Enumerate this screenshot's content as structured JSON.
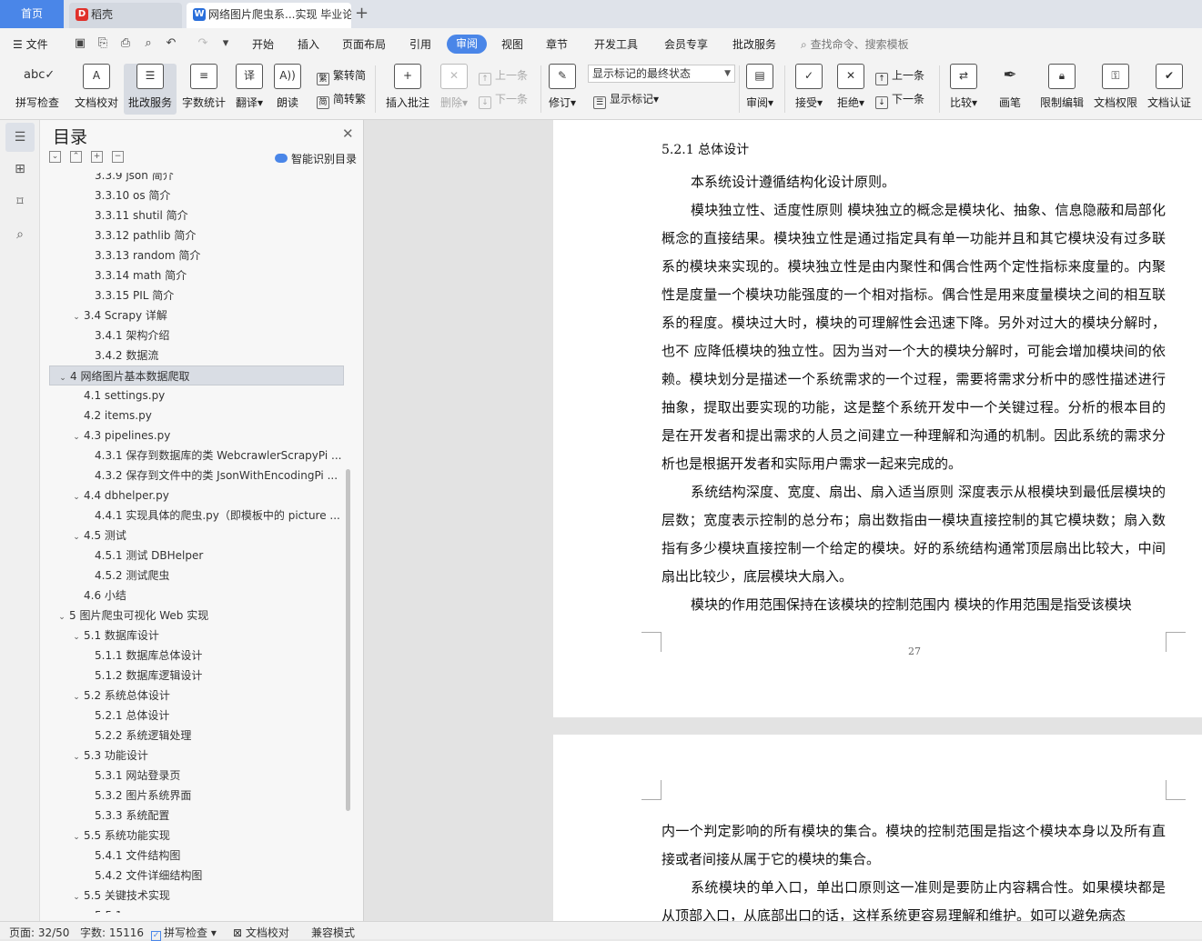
{
  "tabs": {
    "home": "首页",
    "tab1": "稻壳",
    "tab2": "网络图片爬虫系...实现 毕业论"
  },
  "menu": {
    "file": "文件",
    "items": [
      "开始",
      "插入",
      "页面布局",
      "引用",
      "审阅",
      "视图",
      "章节",
      "开发工具",
      "会员专享",
      "批改服务"
    ],
    "active": "审阅",
    "search": "查找命令、搜索模板"
  },
  "ribbon": {
    "spellcheck": "拼写检查",
    "proofread": "文档校对",
    "review_service": "批改服务",
    "word_count": "字数统计",
    "translate": "翻译",
    "read_aloud": "朗读",
    "to_traditional": "繁转简",
    "to_simplified": "简转繁",
    "insert_comment": "插入批注",
    "delete": "删除",
    "prev_comment": "上一条",
    "next_comment": "下一条",
    "revise": "修订",
    "markup_select": "显示标记的最终状态",
    "show_markup": "显示标记",
    "review": "审阅",
    "accept": "接受",
    "reject": "拒绝",
    "prev_change": "上一条",
    "next_change": "下一条",
    "compare": "比较",
    "pen": "画笔",
    "restrict_edit": "限制编辑",
    "doc_permission": "文档权限",
    "doc_auth": "文档认证"
  },
  "toc": {
    "title": "目录",
    "smart": "智能识别目录",
    "items": [
      {
        "label": "3.3.9  json 简介",
        "level": 3
      },
      {
        "label": "3.3.10 os 简介",
        "level": 3
      },
      {
        "label": "3.3.11 shutil 简介",
        "level": 3
      },
      {
        "label": "3.3.12 pathlib 简介",
        "level": 3
      },
      {
        "label": "3.3.13 random 简介",
        "level": 3
      },
      {
        "label": "3.3.14 math 简介",
        "level": 3
      },
      {
        "label": "3.3.15 PIL 简介",
        "level": 3
      },
      {
        "label": "3.4 Scrapy 详解",
        "level": 2,
        "expanded": true
      },
      {
        "label": "3.4.1  架构介绍",
        "level": 3
      },
      {
        "label": "3.4.2  数据流",
        "level": 3
      },
      {
        "label": "4  网络图片基本数据爬取",
        "level": 1,
        "expanded": true,
        "selected": true
      },
      {
        "label": "4.1 settings.py",
        "level": 2
      },
      {
        "label": "4.2 items.py",
        "level": 2
      },
      {
        "label": "4.3 pipelines.py",
        "level": 2,
        "expanded": true
      },
      {
        "label": "4.3.1 保存到数据库的类 WebcrawlerScrapyPi ...",
        "level": 3
      },
      {
        "label": "4.3.2 保存到文件中的类 JsonWithEncodingPi ...",
        "level": 3
      },
      {
        "label": "4.4 dbhelper.py",
        "level": 2,
        "expanded": true
      },
      {
        "label": "4.4.1 实现具体的爬虫.py（即模板中的 picture ...",
        "level": 3
      },
      {
        "label": "4.5 测试",
        "level": 2,
        "expanded": true
      },
      {
        "label": "4.5.1 测试  DBHelper",
        "level": 3
      },
      {
        "label": "4.5.2 测试爬虫",
        "level": 3
      },
      {
        "label": "4.6 小结",
        "level": 2
      },
      {
        "label": "5  图片爬虫可视化 Web 实现",
        "level": 1,
        "expanded": true
      },
      {
        "label": "5.1  数据库设计",
        "level": 2,
        "expanded": true
      },
      {
        "label": "5.1.1  数据库总体设计",
        "level": 3
      },
      {
        "label": "5.1.2  数据库逻辑设计",
        "level": 3
      },
      {
        "label": "5.2  系统总体设计",
        "level": 2,
        "expanded": true
      },
      {
        "label": "5.2.1  总体设计",
        "level": 3
      },
      {
        "label": "5.2.2  系统逻辑处理",
        "level": 3
      },
      {
        "label": "5.3  功能设计",
        "level": 2,
        "expanded": true
      },
      {
        "label": "5.3.1  网站登录页",
        "level": 3
      },
      {
        "label": "5.3.2  图片系统界面",
        "level": 3
      },
      {
        "label": "5.3.3  系统配置",
        "level": 3
      },
      {
        "label": "5.5  系统功能实现",
        "level": 2,
        "expanded": true
      },
      {
        "label": "5.4.1  文件结构图",
        "level": 3
      },
      {
        "label": "5.4.2  文件详细结构图",
        "level": 3
      },
      {
        "label": "5.5  关键技术实现",
        "level": 2,
        "expanded": true
      },
      {
        "label": "5.5.1  ...",
        "level": 3
      }
    ]
  },
  "document": {
    "heading": "5.2.1  总体设计",
    "page1_paragraphs": [
      "本系统设计遵循结构化设计原则。",
      "模块独立性、适度性原则  模块独立的概念是模块化、抽象、信息隐蔽和局部化概念的直接结果。模块独立性是通过指定具有单一功能并且和其它模块没有过多联系的模块来实现的。模块独立性是由内聚性和偶合性两个定性指标来度量的。内聚性是度量一个模块功能强度的一个相对指标。偶合性是用来度量模块之间的相互联系的程度。模块过大时，模块的可理解性会迅速下降。另外对过大的模块分解时，也不  应降低模块的独立性。因为当对一个大的模块分解时，可能会增加模块间的依赖。模块划分是描述一个系统需求的一个过程，需要将需求分析中的感性描述进行抽象，提取出要实现的功能，这是整个系统开发中一个关键过程。分析的根本目的是在开发者和提出需求的人员之间建立一种理解和沟通的机制。因此系统的需求分析也是根据开发者和实际用户需求一起来完成的。",
      "系统结构深度、宽度、扇出、扇入适当原则  深度表示从根模块到最低层模块的层数；宽度表示控制的总分布；扇出数指由一模块直接控制的其它模块数；扇入数指有多少模块直接控制一个给定的模块。好的系统结构通常顶层扇出比较大，中间扇出比较少，底层模块大扇入。",
      "模块的作用范围保持在该模块的控制范围内  模块的作用范围是指受该模块"
    ],
    "page_number": "27",
    "page2_paragraphs": [
      "内一个判定影响的所有模块的集合。模块的控制范围是指这个模块本身以及所有直接或者间接从属于它的模块的集合。",
      "系统模块的单入口，单出口原则这一准则是要防止内容耦合性。如果模块都是从顶部入口，从底部出口的话，这样系统更容易理解和维护。如可以避免病态"
    ]
  },
  "status": {
    "page": "页面: 32/50",
    "words": "字数: 15116",
    "spell": "拼写检查",
    "proof": "文档校对",
    "compat": "兼容模式"
  }
}
